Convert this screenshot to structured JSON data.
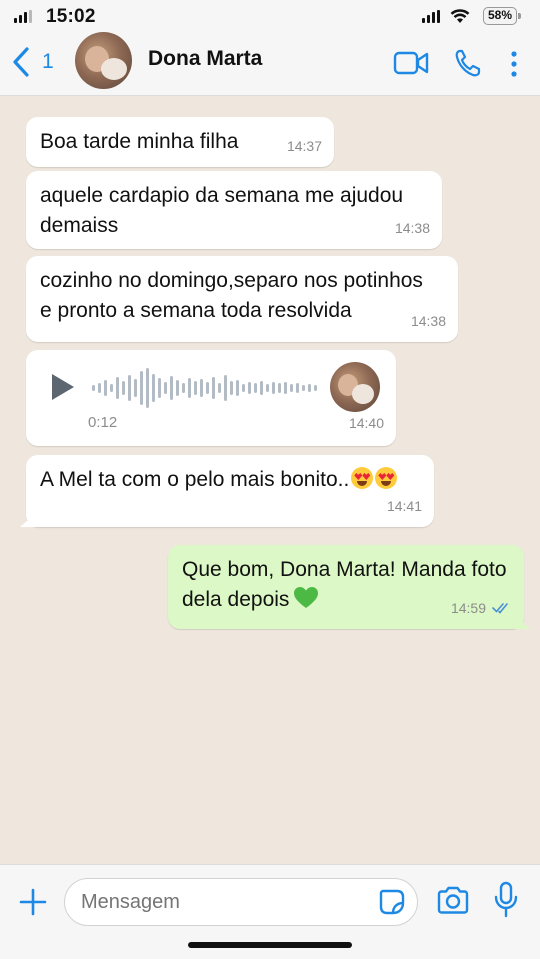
{
  "status_bar": {
    "time": "15:02",
    "battery": "58%"
  },
  "header": {
    "back_count": "1",
    "contact_name": "Dona Marta"
  },
  "messages": [
    {
      "text": "Boa tarde minha filha",
      "time": "14:37"
    },
    {
      "line1": "aquele cardapio da semana me ajudou",
      "line2": "demaiss",
      "time": "14:38"
    },
    {
      "line1": "cozinho no domingo,separo nos potinhos",
      "line2": "e pronto a semana toda resolvida",
      "time": "14:38"
    },
    {
      "type": "voice",
      "duration": "0:12",
      "time": "14:40"
    },
    {
      "text": "A Mel ta com o pelo mais bonito..",
      "emoji": "heart-eyes-emoji",
      "time": "14:41"
    },
    {
      "line1": "Que bom, Dona Marta! Manda foto",
      "line2": "dela depois",
      "emoji": "green-heart-emoji",
      "time": "14:59",
      "status": "read"
    }
  ],
  "composer": {
    "placeholder": "Mensagem"
  },
  "colors": {
    "accent": "#1e88e5",
    "incoming": "#ffffff",
    "outgoing": "#dcf8c6",
    "wallpaper": "#efe7dd"
  },
  "icons": [
    "back-chevron-icon",
    "video-call-icon",
    "phone-icon",
    "more-icon",
    "play-icon",
    "read-check-icon",
    "plus-icon",
    "sticker-icon",
    "camera-icon",
    "mic-icon"
  ]
}
